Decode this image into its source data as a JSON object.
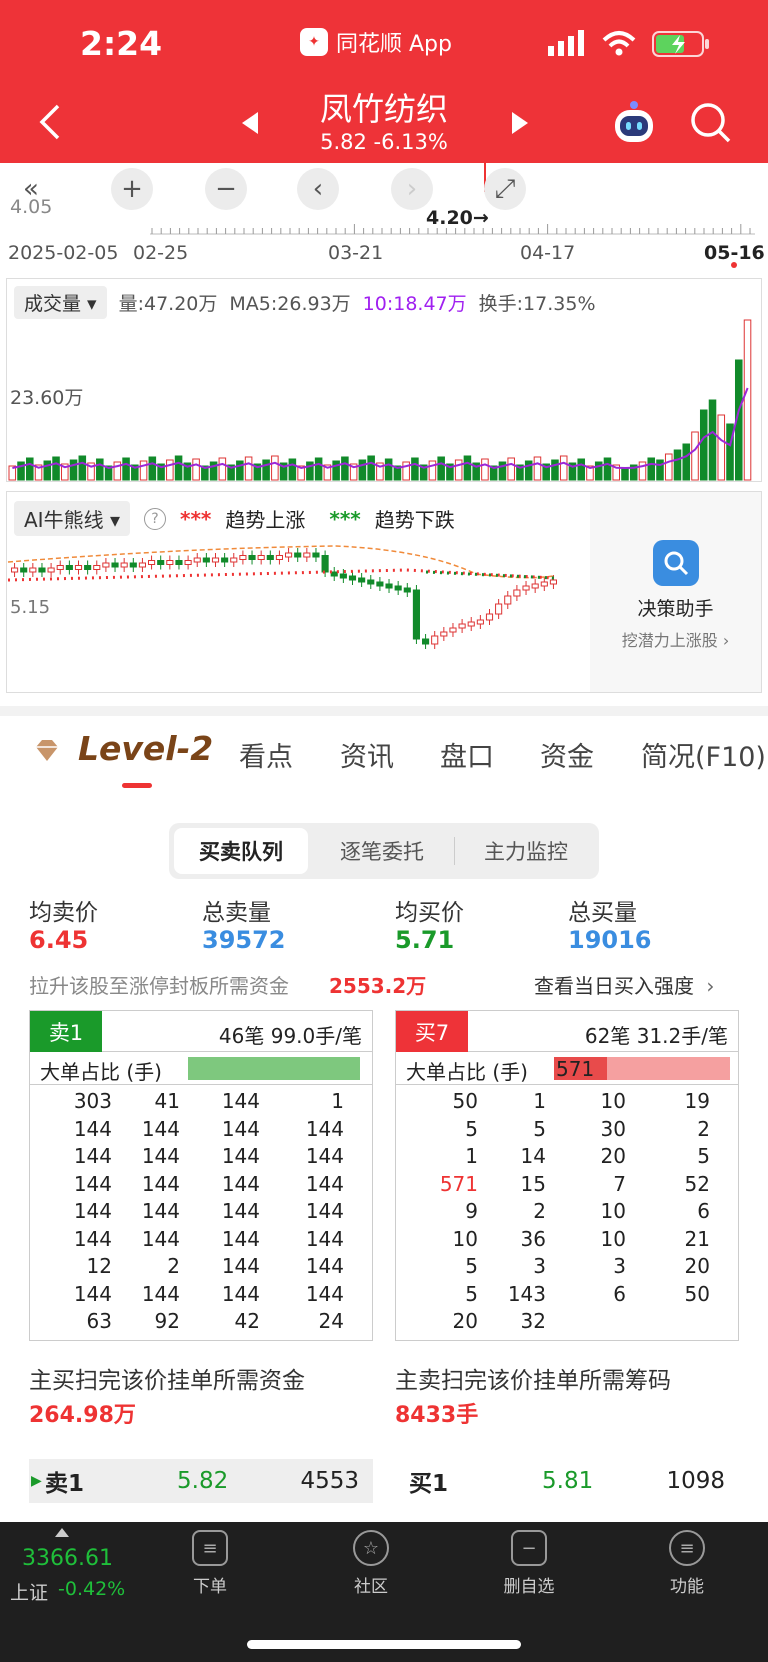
{
  "status_bar": {
    "time": "2:24",
    "app_badge_label": "同花顺 App"
  },
  "header": {
    "stock_name": "凤竹纺织",
    "quote": "5.82  -6.13%",
    "colors": {
      "bg": "#ee3338"
    }
  },
  "kline": {
    "price_label_left": "4.05",
    "price_marker": "4.20→",
    "dates": [
      "2025-02-05",
      "02-25",
      "03-21",
      "04-17",
      "05-16"
    ]
  },
  "volume": {
    "dropdown": "成交量",
    "qty": "量:47.20万",
    "ma5": "MA5:26.93万",
    "ma10": "10:18.47万",
    "turnover": "换手:17.35%",
    "axis_label": "23.60万"
  },
  "ai": {
    "dropdown": "AI牛熊线",
    "legend_up": "趋势上涨",
    "legend_down": "趋势下跌",
    "price_label": "5.15",
    "assistant_title": "决策助手",
    "assistant_sub": "挖潜力上涨股 ›"
  },
  "tabs": {
    "level2": "Level-2",
    "items": [
      "看点",
      "资讯",
      "盘口",
      "资金",
      "简况(F10)"
    ]
  },
  "segment": [
    "买卖队列",
    "逐笔委托",
    "主力监控"
  ],
  "summary": [
    {
      "label": "均卖价",
      "value": "6.45",
      "color": "#e33"
    },
    {
      "label": "总卖量",
      "value": "39572",
      "color": "#3a8de0"
    },
    {
      "label": "均买价",
      "value": "5.71",
      "color": "#1a9a2a"
    },
    {
      "label": "总买量",
      "value": "19016",
      "color": "#3a8de0"
    }
  ],
  "limit_up": {
    "label": "拉升该股至涨停封板所需资金",
    "value": "2553.2万",
    "link": "查看当日买入强度"
  },
  "sell_queue": {
    "tag": "卖1",
    "meta": "46笔  99.0手/笔",
    "big_label": "大单占比 (手)",
    "big_fill_ratio": 0.98,
    "rows": [
      [
        "303",
        "41",
        "144",
        "1"
      ],
      [
        "144",
        "144",
        "144",
        "144"
      ],
      [
        "144",
        "144",
        "144",
        "144"
      ],
      [
        "144",
        "144",
        "144",
        "144"
      ],
      [
        "144",
        "144",
        "144",
        "144"
      ],
      [
        "144",
        "144",
        "144",
        "144"
      ],
      [
        "12",
        "2",
        "144",
        "144"
      ],
      [
        "144",
        "144",
        "144",
        "144"
      ],
      [
        "63",
        "92",
        "42",
        "24"
      ]
    ]
  },
  "buy_queue": {
    "tag": "买7",
    "meta": "62笔  31.2手/笔",
    "big_label": "大单占比 (手)",
    "big_value": "571",
    "big_fill_ratio": 0.3,
    "rows": [
      [
        "50",
        "1",
        "10",
        "19"
      ],
      [
        "5",
        "5",
        "30",
        "2"
      ],
      [
        "1",
        "14",
        "20",
        "5"
      ],
      [
        "571",
        "15",
        "7",
        "52"
      ],
      [
        "9",
        "2",
        "10",
        "6"
      ],
      [
        "10",
        "36",
        "10",
        "21"
      ],
      [
        "5",
        "3",
        "3",
        "20"
      ],
      [
        "5",
        "143",
        "6",
        "50"
      ],
      [
        "20",
        "32",
        "",
        ""
      ]
    ]
  },
  "sweep": {
    "sell_label": "主买扫完该价挂单所需资金",
    "sell_value": "264.98万",
    "buy_label": "主卖扫完该价挂单所需筹码",
    "buy_value": "8433手"
  },
  "quotes": {
    "sell": {
      "label": "卖1",
      "price": "5.82",
      "vol": "4553"
    },
    "buy": {
      "label": "买1",
      "price": "5.81",
      "vol": "1098"
    }
  },
  "bottom": {
    "index_value": "3366.61",
    "index_name": "上证",
    "index_change": "-0.42%",
    "nav": [
      "下单",
      "社区",
      "删自选",
      "功能"
    ]
  }
}
